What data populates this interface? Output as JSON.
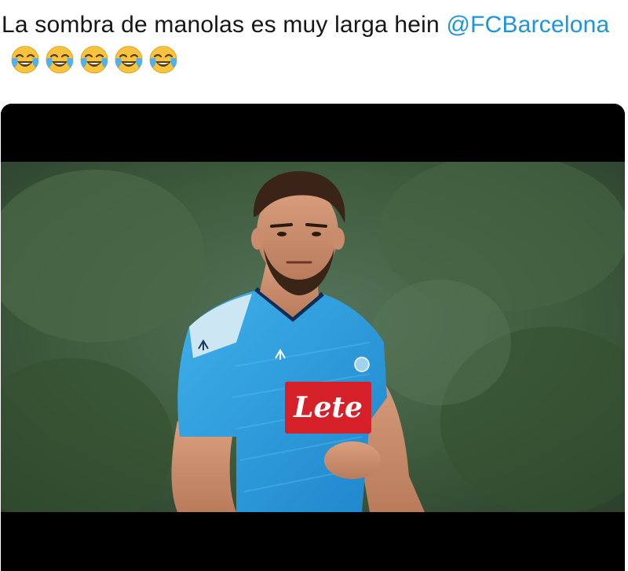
{
  "tweet": {
    "text": "La sombra de manolas es muy larga hein ",
    "mention": "@FCBarcelona",
    "emojis": [
      "face-with-tears-of-joy",
      "face-with-tears-of-joy",
      "face-with-tears-of-joy",
      "face-with-tears-of-joy",
      "face-with-tears-of-joy"
    ]
  },
  "media": {
    "description_icon": "photo-of-footballer",
    "shirt_sponsor": "Lete",
    "colors": {
      "shirt": "#2c9ee0",
      "sponsor_box": "#d5202a",
      "background_foliage": "#3f5e3a",
      "letterbox": "#000000"
    }
  }
}
